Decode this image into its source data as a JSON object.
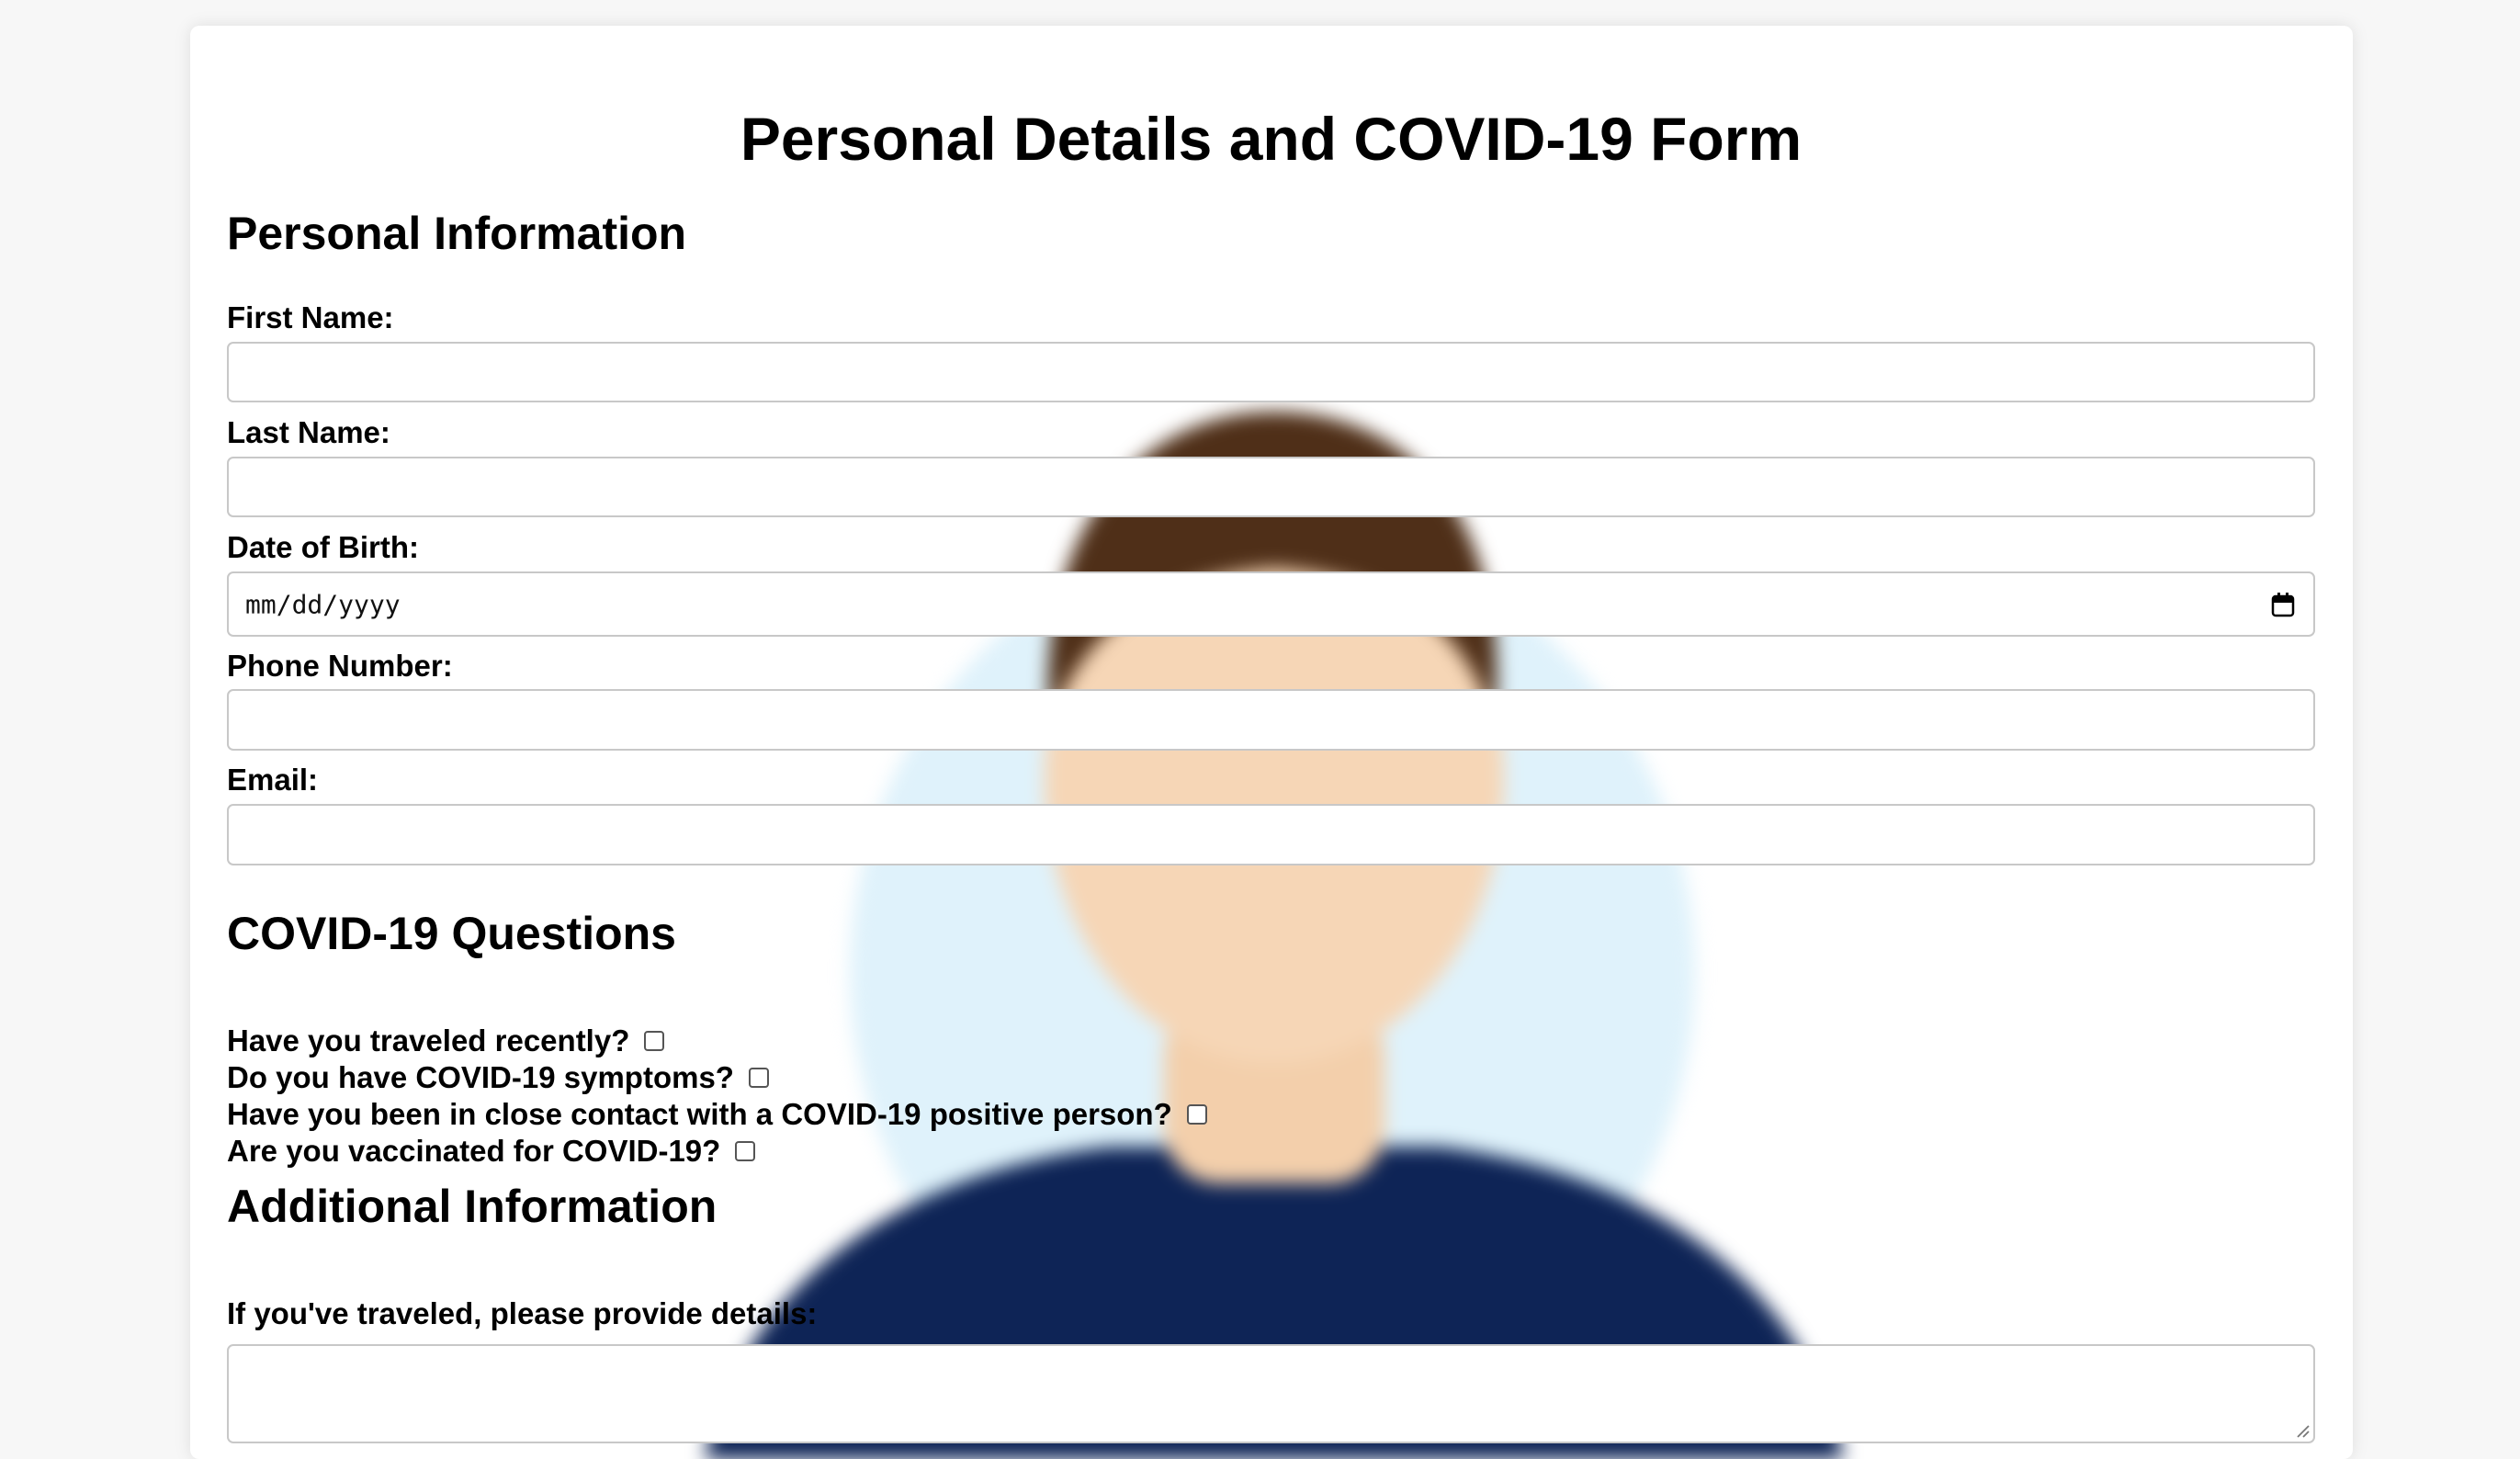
{
  "form": {
    "title": "Personal Details and COVID-19 Form"
  },
  "personal": {
    "heading": "Personal Information",
    "first_name_label": "First Name:",
    "first_name_value": "",
    "last_name_label": "Last Name:",
    "last_name_value": "",
    "dob_label": "Date of Birth:",
    "dob_placeholder": "mm/dd/yyyy",
    "phone_label": "Phone Number:",
    "phone_value": "",
    "email_label": "Email:",
    "email_value": ""
  },
  "covid": {
    "heading": "COVID-19 Questions",
    "questions": [
      {
        "label": "Have you traveled recently?",
        "checked": false
      },
      {
        "label": "Do you have COVID-19 symptoms?",
        "checked": false
      },
      {
        "label": "Have you been in close contact with a COVID-19 positive person?",
        "checked": false
      },
      {
        "label": "Are you vaccinated for COVID-19?",
        "checked": false
      }
    ]
  },
  "additional": {
    "heading": "Additional Information",
    "travel_details_label": "If you've traveled, please provide details:",
    "travel_details_value": ""
  },
  "icons": {
    "date_picker": "calendar-icon",
    "textarea_resize": "resize-handle-icon"
  },
  "colors": {
    "page_bg": "#f7f7f7",
    "card_bg": "#ffffff",
    "field_border": "#c8c8c8",
    "background_figure_shirt": "#0e2456",
    "background_figure_hair": "#4f2f18",
    "background_figure_skin": "#f6d6b6",
    "background_figure_sky": "#dff2fb"
  }
}
